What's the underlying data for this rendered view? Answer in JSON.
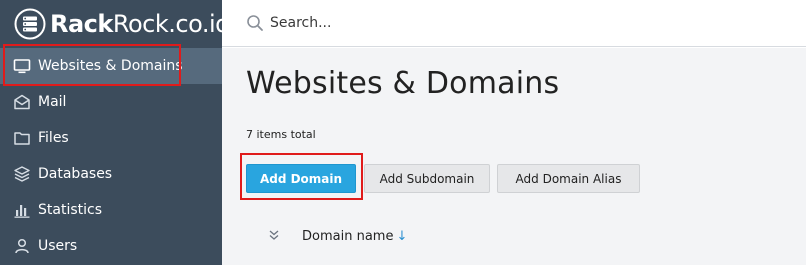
{
  "brand": {
    "name_bold": "Rack",
    "name_rest": "Rock.co.id",
    "logo_icon": "server-stack-icon"
  },
  "search": {
    "placeholder": "Search...",
    "icon": "search-icon"
  },
  "sidebar": {
    "items": [
      {
        "label": "Websites & Domains",
        "icon": "monitor-icon",
        "active": true
      },
      {
        "label": "Mail",
        "icon": "envelope-icon"
      },
      {
        "label": "Files",
        "icon": "folder-icon"
      },
      {
        "label": "Databases",
        "icon": "database-icon"
      },
      {
        "label": "Statistics",
        "icon": "bar-chart-icon"
      },
      {
        "label": "Users",
        "icon": "user-icon"
      }
    ]
  },
  "main": {
    "title": "Websites & Domains",
    "items_total": "7 items total",
    "buttons": {
      "add_domain": "Add Domain",
      "add_subdomain": "Add Subdomain",
      "add_domain_alias": "Add Domain Alias"
    },
    "table": {
      "columns": [
        {
          "label": "Domain name",
          "sort": "↓"
        }
      ]
    }
  },
  "colors": {
    "sidebar_bg": "#3c4c5c",
    "sidebar_active_bg": "#566a7d",
    "primary_button": "#29a5df",
    "highlight": "#e01b1b"
  }
}
